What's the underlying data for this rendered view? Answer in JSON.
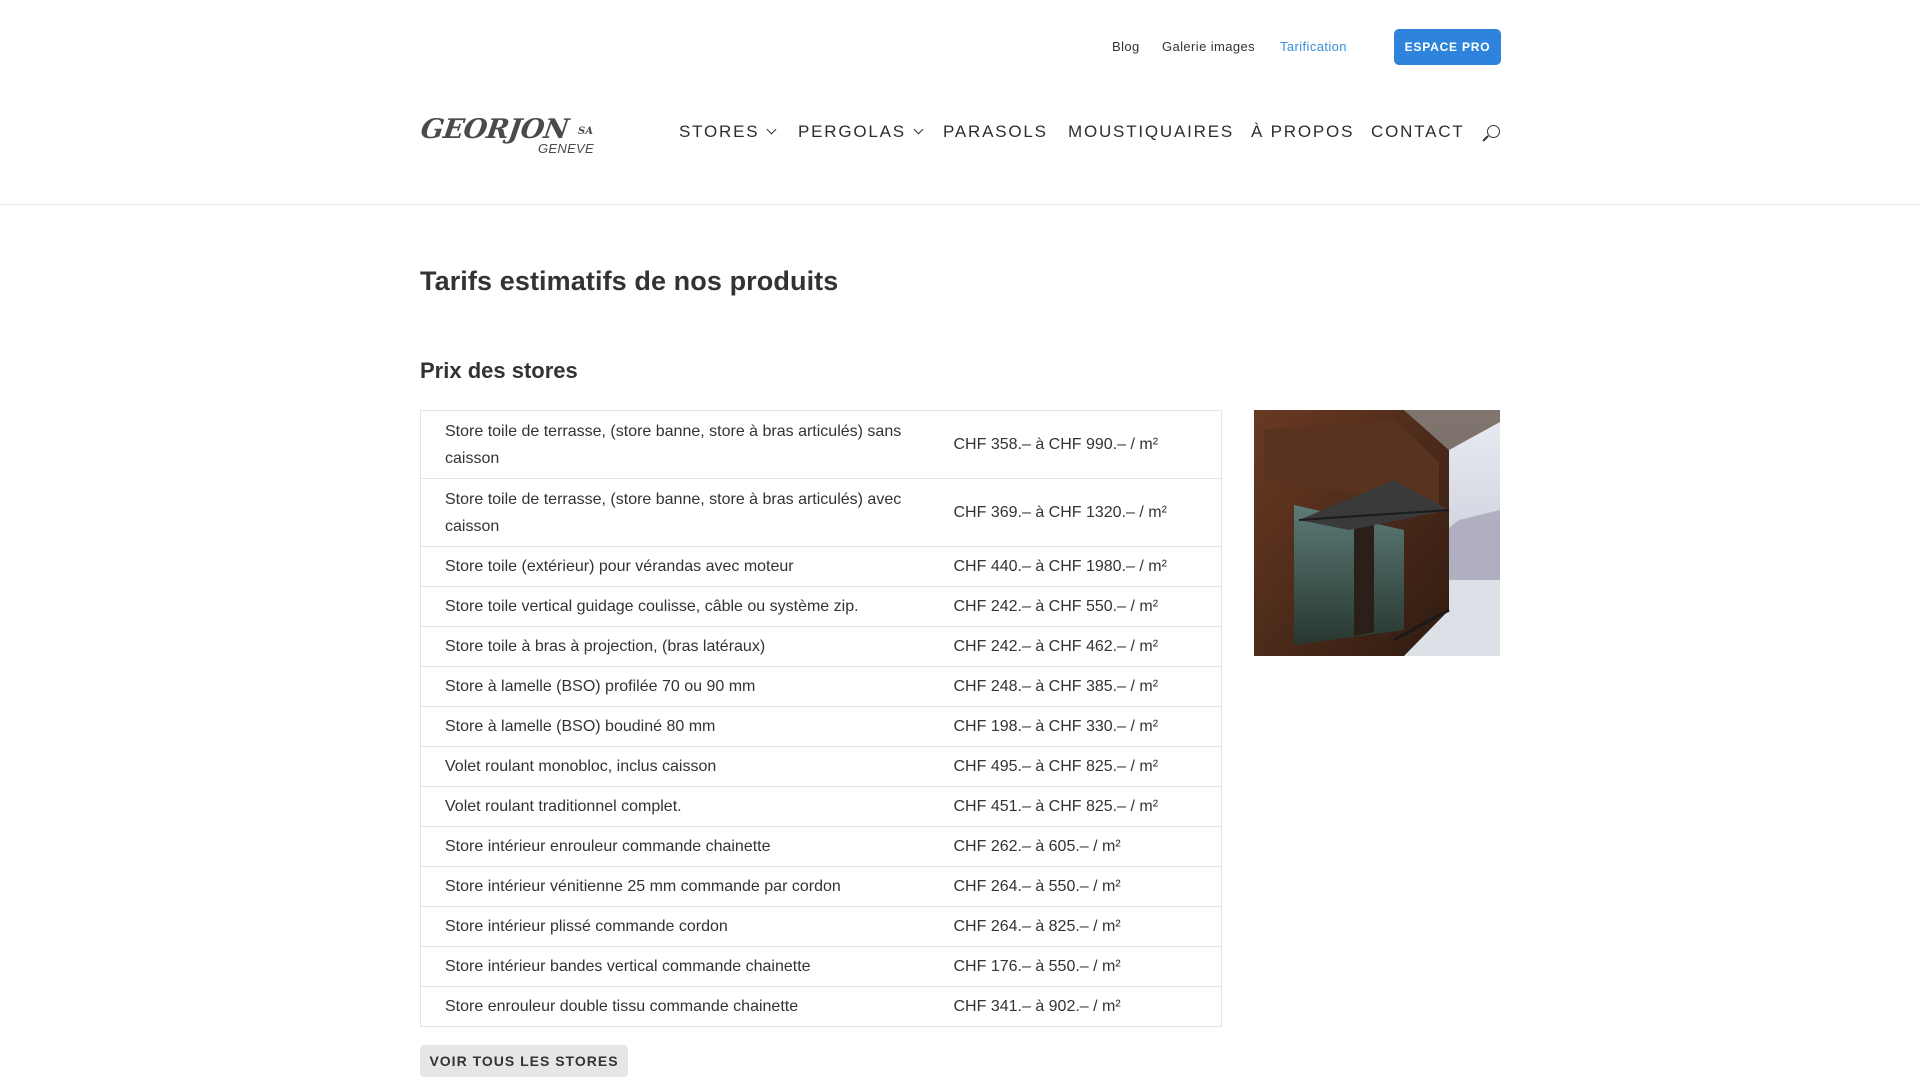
{
  "topbar": {
    "links": [
      {
        "label": "Blog",
        "active": false
      },
      {
        "label": "Galerie images",
        "active": false
      },
      {
        "label": "Tarification",
        "active": true
      }
    ],
    "pro_button": "ESPACE PRO"
  },
  "logo": {
    "main": "GEORJON",
    "suffix": "SA",
    "sub": "GENEVE"
  },
  "nav": {
    "items": [
      {
        "label": "STORES",
        "has_dropdown": true
      },
      {
        "label": "PERGOLAS",
        "has_dropdown": true
      },
      {
        "label": "PARASOLS",
        "has_dropdown": false
      },
      {
        "label": "MOUSTIQUAIRES",
        "has_dropdown": false
      },
      {
        "label": "À PROPOS",
        "has_dropdown": false
      },
      {
        "label": "CONTACT",
        "has_dropdown": false
      }
    ],
    "search_icon": "search-icon"
  },
  "main": {
    "title": "Tarifs estimatifs de nos produits",
    "section_title": "Prix des stores",
    "rows": [
      {
        "product": "Store toile de terrasse, (store banne, store à bras articulés) sans caisson",
        "price": "CHF 358.– à CHF 990.– / m²"
      },
      {
        "product": "Store toile de terrasse, (store banne, store à bras articulés) avec caisson",
        "price": "CHF 369.– à CHF 1320.– / m²"
      },
      {
        "product": "Store toile (extérieur) pour vérandas avec moteur",
        "price": "CHF 440.– à CHF 1980.– / m²"
      },
      {
        "product": "Store toile vertical guidage coulisse, câble ou système zip.",
        "price": "CHF 242.– à CHF 550.– / m²"
      },
      {
        "product": "Store toile à bras à projection, (bras latéraux)",
        "price": "CHF 242.– à CHF 462.– / m²"
      },
      {
        "product": "Store à lamelle (BSO)  profilée 70 ou 90 mm",
        "price": "CHF 248.– à CHF 385.– / m²"
      },
      {
        "product": "Store à lamelle (BSO) boudiné 80 mm",
        "price": "CHF 198.– à CHF 330.– / m²"
      },
      {
        "product": "Volet roulant monobloc, inclus caisson",
        "price": "CHF 495.– à CHF 825.– / m²"
      },
      {
        "product": "Volet roulant traditionnel complet.",
        "price": "CHF 451.– à CHF 825.– / m²"
      },
      {
        "product": "Store intérieur enrouleur commande chainette",
        "price": "CHF 262.– à 605.– / m²"
      },
      {
        "product": "Store intérieur vénitienne 25 mm commande par cordon",
        "price": "CHF 264.– à 550.– / m²"
      },
      {
        "product": "Store intérieur plissé commande cordon",
        "price": "CHF 264.– à 825.– / m²"
      },
      {
        "product": "Store intérieur bandes vertical commande chainette",
        "price": "CHF 176.– à 550.– / m²"
      },
      {
        "product": "Store enrouleur double tissu commande chainette",
        "price": "CHF 341.– à 902.– / m²"
      }
    ],
    "button_all": "VOIR TOUS LES STORES"
  },
  "colors": {
    "accent": "#2e84dc",
    "active_link": "#3b8fd9",
    "text": "#333333",
    "border": "#e4e4e4",
    "button_grey": "#e6e6e6"
  }
}
